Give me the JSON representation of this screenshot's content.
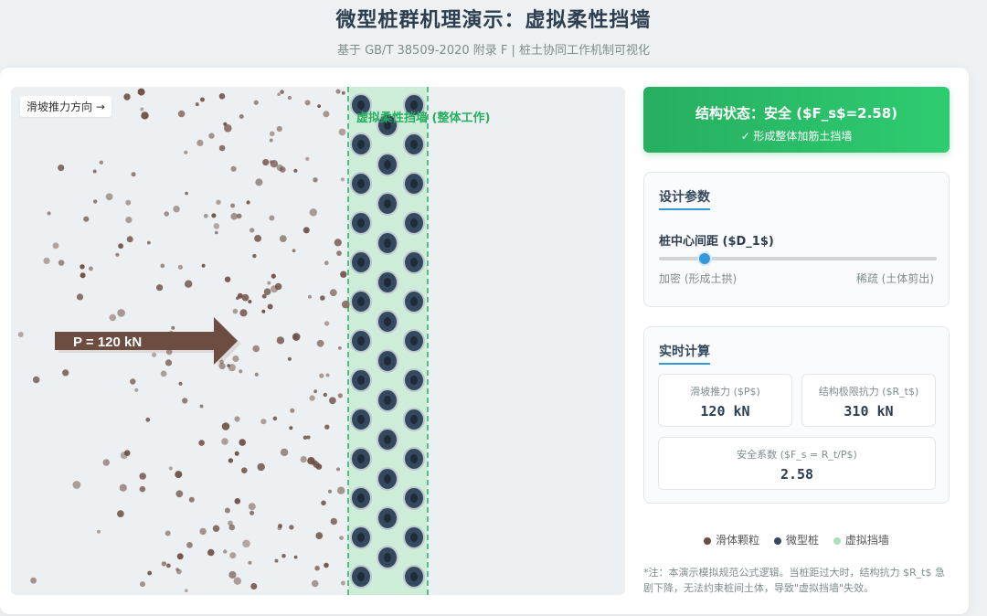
{
  "header": {
    "title": "微型桩群机理演示：虚拟柔性挡墙",
    "subtitle": "基于 GB/T 38509-2020 附录 F | 桩土协同工作机制可视化"
  },
  "simulation": {
    "direction_label": "滑坡推力方向 →",
    "wall_label": "虚拟柔性挡墙 (整体工作)",
    "force_label": "P = 120 kN",
    "colors": {
      "soil": "#6d4c41",
      "pile": "#34495e",
      "wall": "#c8ecd4",
      "wall_border": "#27ae60"
    }
  },
  "status": {
    "title": "结构状态：安全 ($F_s$=2.58)",
    "detail": "✓ 形成整体加筋土挡墙"
  },
  "params": {
    "title": "设计参数",
    "slider_label": "桩中心间距 ($D_1$)",
    "min_label": "加密 (形成土拱)",
    "max_label": "稀疏 (土体剪出)"
  },
  "calc": {
    "title": "实时计算",
    "thrust_label": "滑坡推力 ($P$)",
    "thrust_value": "120 kN",
    "resist_label": "结构极限抗力 ($R_t$)",
    "resist_value": "310 kN",
    "fs_label": "安全系数 ($F_s = R_t/P$)",
    "fs_value": "2.58"
  },
  "legend": {
    "soil": "滑体颗粒",
    "pile": "微型桩",
    "wall": "虚拟挡墙"
  },
  "note": "*注：本演示模拟规范公式逻辑。当桩距过大时，结构抗力 $R_t$ 急剧下降，无法约束桩间土体，导致\"虚拟挡墙\"失效。"
}
